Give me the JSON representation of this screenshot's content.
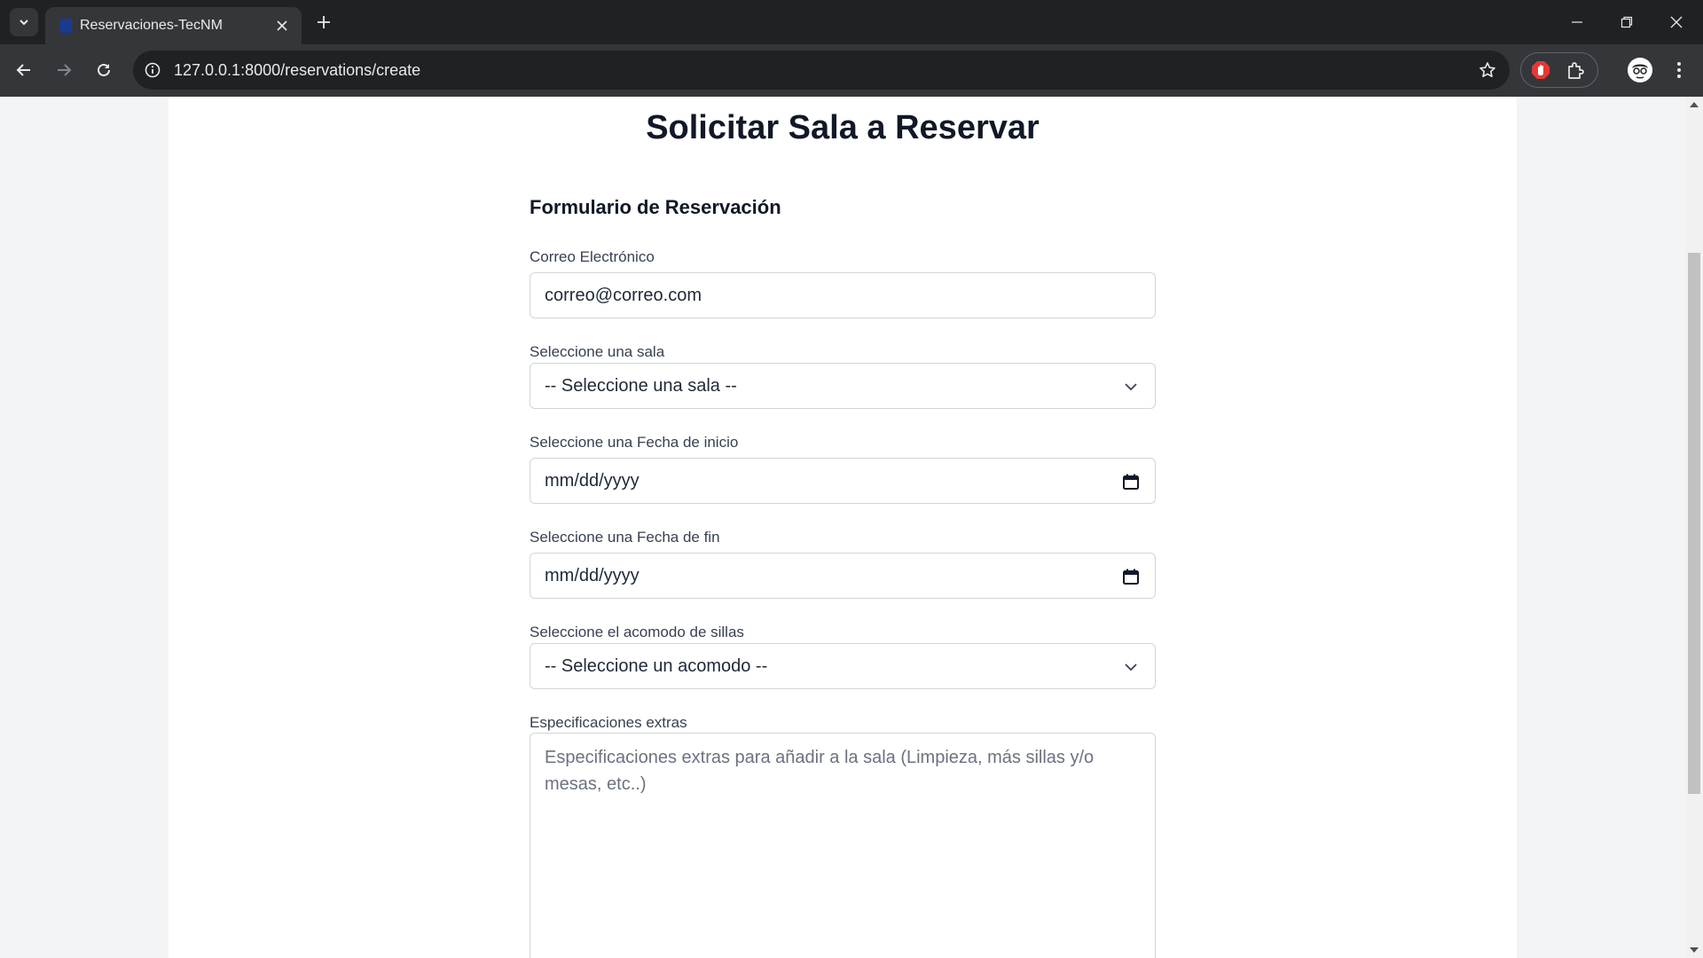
{
  "browser": {
    "tab_title": "Reservaciones-TecNM",
    "url": "127.0.0.1:8000/reservations/create",
    "icons": {
      "tab_search": "chevron-down-icon",
      "close_tab": "close-icon",
      "new_tab": "plus-icon",
      "back": "back-arrow-icon",
      "forward": "forward-arrow-icon",
      "reload": "reload-icon",
      "site_info": "info-icon",
      "bookmark": "star-icon",
      "extension_adblock": "adblock-icon",
      "extensions": "puzzle-icon",
      "profile": "avatar",
      "menu": "kebab-icon",
      "minimize": "minimize-icon",
      "restore": "restore-icon",
      "close_window": "close-icon"
    }
  },
  "page": {
    "title": "Solicitar Sala a Reservar",
    "form": {
      "title": "Formulario de Reservación",
      "email": {
        "label": "Correo Electrónico",
        "value": "correo@correo.com"
      },
      "room": {
        "label": "Seleccione una sala",
        "selected": "-- Seleccione una sala --"
      },
      "start_date": {
        "label": "Seleccione una Fecha de inicio",
        "value": "mm/dd/yyyy"
      },
      "end_date": {
        "label": "Seleccione una Fecha de fin",
        "value": "mm/dd/yyyy"
      },
      "seating": {
        "label": "Seleccione el acomodo de sillas",
        "selected": "-- Seleccione un acomodo --"
      },
      "extras": {
        "label": "Especificaciones extras",
        "placeholder": "Especificaciones extras para añadir a la sala (Limpieza, más sillas y/o mesas, etc..)"
      }
    }
  },
  "colors": {
    "chrome_dark": "#202124",
    "chrome_toolbar": "#35363a",
    "page_bg": "#f3f4f6",
    "card_bg": "#ffffff",
    "border": "#d1d5db",
    "heading": "#111827"
  }
}
